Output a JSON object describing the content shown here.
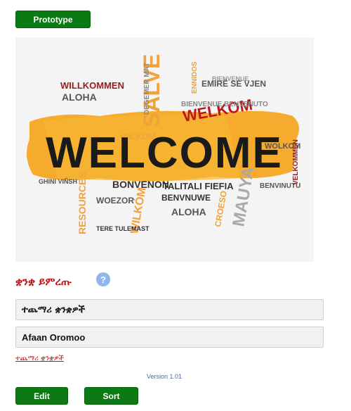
{
  "toolbar": {
    "prototype_label": "Prototype"
  },
  "hero": {
    "big_word": "WELCOME",
    "words": [
      {
        "t": "WILLKOMMEN",
        "c": "#9b1c1c"
      },
      {
        "t": "ALOHA",
        "c": "#555555"
      },
      {
        "t": "SALVE",
        "c": "#f2a23a"
      },
      {
        "t": "DEGEMER MAT",
        "c": "#8a8a8a"
      },
      {
        "t": "WELKOM",
        "c": "#c0151b"
      },
      {
        "t": "BIENVENUE",
        "c": "#9a9a9a"
      },
      {
        "t": "WILKÓM",
        "c": "#f2a23a"
      },
      {
        "t": "WOLKOM",
        "c": "#555555"
      },
      {
        "t": "BONVENON",
        "c": "#333333"
      },
      {
        "t": "TALITALI FIEFIA",
        "c": "#333333"
      },
      {
        "t": "MAUYA",
        "c": "#aaaaaa"
      },
      {
        "t": "BENVINUTU",
        "c": "#555555"
      },
      {
        "t": "BENVNUWE",
        "c": "#333333"
      },
      {
        "t": "ALOHA",
        "c": "#555555"
      },
      {
        "t": "RESOURCES",
        "c": "#f2a23a"
      },
      {
        "t": "WILKÓM",
        "c": "#f2a23a"
      },
      {
        "t": "EMIRË SE VJEN",
        "c": "#555555"
      },
      {
        "t": "BIENVENUE BENVENUTO",
        "c": "#888888"
      },
      {
        "t": "VELKOMMEN",
        "c": "#9b1c1c"
      },
      {
        "t": "CROESO",
        "c": "#f2a23a"
      },
      {
        "t": "ENNIDOS",
        "c": "#f2a23a"
      },
      {
        "t": "TERE TULEMAST",
        "c": "#333333"
      },
      {
        "t": "WOEZOR",
        "c": "#555555"
      },
      {
        "t": "GHINI VIÑSH",
        "c": "#555555"
      }
    ]
  },
  "languages": {
    "heading": "ቋንቋ ይምረጡ",
    "help_icon": "help-icon",
    "items": [
      "ተጨማሪ ቋንቋዎች",
      "Afaan Oromoo"
    ],
    "add_link": "ተጨማሪ ቋንቋዎች"
  },
  "footer": {
    "version": "Version 1.01",
    "edit_label": "Edit",
    "sort_label": "Sort"
  },
  "colors": {
    "button_green": "#0b7a12",
    "heading_red": "#c0151b",
    "help_blue": "#8fb7ea"
  }
}
